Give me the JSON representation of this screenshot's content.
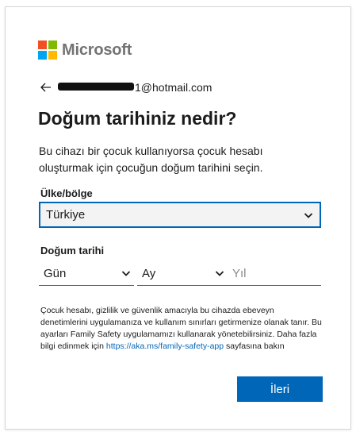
{
  "brand": {
    "name": "Microsoft",
    "colors": [
      "#f25022",
      "#7fba00",
      "#00a4ef",
      "#ffb900"
    ]
  },
  "identity": {
    "email_visible": "1@hotmail.com",
    "back_icon": "arrow-left-icon"
  },
  "page": {
    "title": "Doğum tarihiniz nedir?",
    "description": "Bu cihazı bir çocuk kullanıyorsa çocuk hesabı oluşturmak için çocuğun doğum tarihini seçin."
  },
  "country": {
    "label": "Ülke/bölge",
    "value": "Türkiye"
  },
  "birthdate": {
    "label": "Doğum tarihi",
    "day_value": "Gün",
    "month_value": "Ay",
    "year_placeholder": "Yıl"
  },
  "info": {
    "text": "Çocuk hesabı, gizlilik ve güvenlik amacıyla bu cihazda ebeveyn denetimlerini uygulamanıza ve kullanım sınırları getirmenize olanak tanır. Bu ayarları Family Safety uygulamamızı kullanarak yönetebilirsiniz. Daha fazla bilgi edinmek için",
    "link_text": "https://aka.ms/family-safety-app",
    "suffix": "sayfasına bakın"
  },
  "actions": {
    "next_label": "İleri"
  },
  "colors": {
    "accent": "#0067b8",
    "logo_text": "#737373"
  }
}
